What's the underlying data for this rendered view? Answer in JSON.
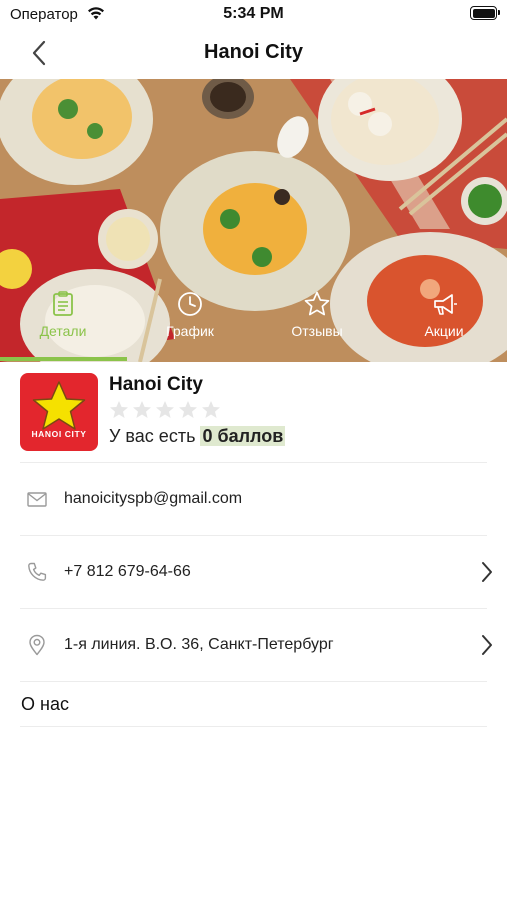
{
  "status_bar": {
    "carrier": "Оператор",
    "time": "5:34 PM"
  },
  "nav": {
    "title": "Hanoi City"
  },
  "tabs": [
    {
      "label": "Детали",
      "icon": "info-list-icon",
      "active": true
    },
    {
      "label": "График",
      "icon": "clock-icon",
      "active": false
    },
    {
      "label": "Отзывы",
      "icon": "star-outline-icon",
      "active": false
    },
    {
      "label": "Акции",
      "icon": "megaphone-icon",
      "active": false
    }
  ],
  "profile": {
    "name": "Hanoi City",
    "logo_text": "HANOI CITY",
    "rating_stars": 0,
    "rating_max": 5,
    "points_prefix": "У вас есть",
    "points_value": "0 баллов"
  },
  "contacts": {
    "email": "hanoicityspb@gmail.com",
    "phone": "+7 812 679-64-66",
    "address": "1-я линия. В.О. 36, Санкт-Петербург"
  },
  "about": {
    "label": "О нас"
  },
  "colors": {
    "accent": "#8bc34a",
    "logo_red": "#e3262d",
    "star_yellow": "#f5e100",
    "points_highlight": "#dfe9cf"
  }
}
